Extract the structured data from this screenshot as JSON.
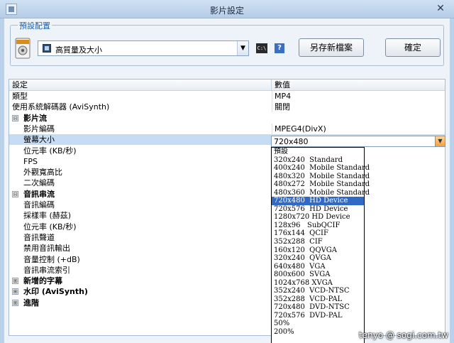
{
  "window": {
    "title": "影片設定"
  },
  "presets": {
    "legend": "預設配置",
    "selected": "高質量及大小",
    "save_new_label": "另存新檔案",
    "ok_label": "確定"
  },
  "grid": {
    "header_setting": "設定",
    "header_value": "數值",
    "rows": [
      {
        "kind": "prop",
        "label": "類型",
        "value": "MP4"
      },
      {
        "kind": "prop",
        "label": "使用系統解碼器 (AviSynth)",
        "value": "關閉"
      },
      {
        "kind": "cat",
        "label": "影片流",
        "expander": "⊟"
      },
      {
        "kind": "sub",
        "label": "影片編碼",
        "value": "MPEG4(DivX)"
      },
      {
        "kind": "sub",
        "label": "螢幕大小",
        "value": "720x480",
        "selected": true
      },
      {
        "kind": "sub",
        "label": "位元率 (KB/秒)",
        "value": ""
      },
      {
        "kind": "sub",
        "label": "FPS",
        "value": ""
      },
      {
        "kind": "sub",
        "label": "外觀寬高比",
        "value": ""
      },
      {
        "kind": "sub",
        "label": "二次編碼",
        "value": ""
      },
      {
        "kind": "cat",
        "label": "音訊串流",
        "expander": "⊟"
      },
      {
        "kind": "sub",
        "label": "音訊編碼",
        "value": ""
      },
      {
        "kind": "sub",
        "label": "採樣率 (赫茲)",
        "value": ""
      },
      {
        "kind": "sub",
        "label": "位元率 (KB/秒)",
        "value": ""
      },
      {
        "kind": "sub",
        "label": "音訊聲道",
        "value": ""
      },
      {
        "kind": "sub",
        "label": "禁用音訊輸出",
        "value": ""
      },
      {
        "kind": "sub",
        "label": "音量控制 (+dB)",
        "value": ""
      },
      {
        "kind": "sub",
        "label": "音訊串流索引",
        "value": ""
      },
      {
        "kind": "cat",
        "label": "新增的字幕",
        "expander": "⊞"
      },
      {
        "kind": "cat",
        "label": "水印 (AviSynth)",
        "expander": "⊞"
      },
      {
        "kind": "cat",
        "label": "進階",
        "expander": "⊞"
      }
    ]
  },
  "resolution": {
    "current": "720x480",
    "options": [
      "預設",
      "320x240  Standard",
      "400x240  Mobile Standard",
      "480x320  Mobile Standard",
      "480x272  Mobile Standard",
      "480x360  Mobile Standard",
      "720x480  HD Device",
      "720x576  HD Device",
      "1280x720 HD Device",
      "128x96   SubQCIF",
      "176x144  QCIF",
      "352x288  CIF",
      "160x120  QQVGA",
      "320x240  QVGA",
      "640x480  VGA",
      "800x600  SVGA",
      "1024x768 XVGA",
      "352x240  VCD-NTSC",
      "352x288  VCD-PAL",
      "720x480  DVD-NTSC",
      "720x576  DVD-PAL",
      "50%",
      "200%"
    ],
    "selected_index": 6
  },
  "watermark": "tenyo  @ sogi.com.tw",
  "colors": {
    "selection": "#3169c6",
    "row_highlight": "#c6dcf4",
    "accent": "#1d5fa8"
  }
}
